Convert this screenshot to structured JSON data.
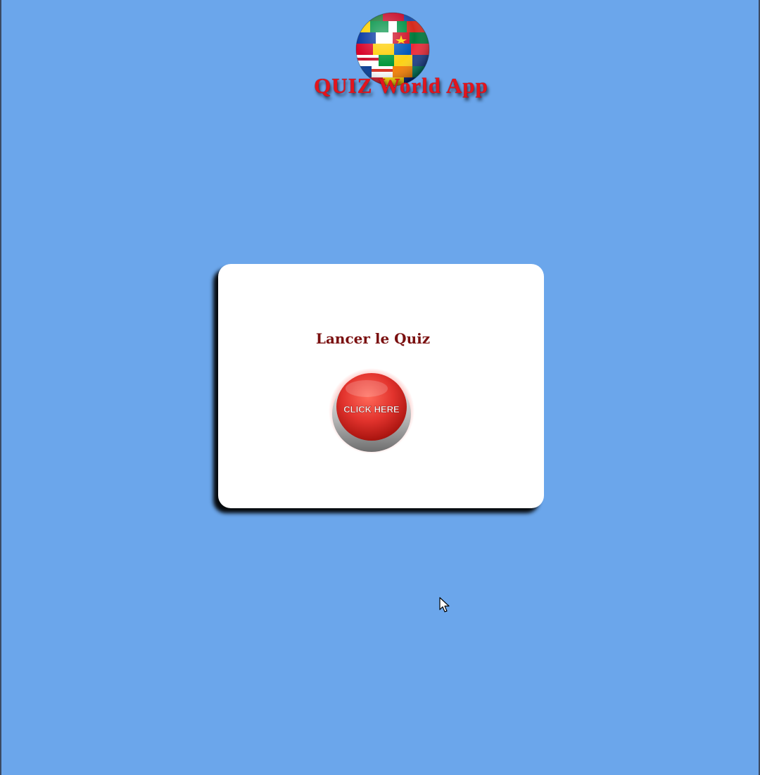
{
  "app": {
    "title": "QUIZ World App",
    "logo_icon": "globe-flags-icon"
  },
  "start_card": {
    "heading": "Lancer le Quiz",
    "button_label": "CLICK HERE",
    "button_icon": "red-push-button"
  },
  "colors": {
    "background": "#6ba6eb",
    "title_red": "#e3141c",
    "heading_dark_red": "#7a1010",
    "button_red": "#e2332d",
    "card": "#ffffff"
  }
}
